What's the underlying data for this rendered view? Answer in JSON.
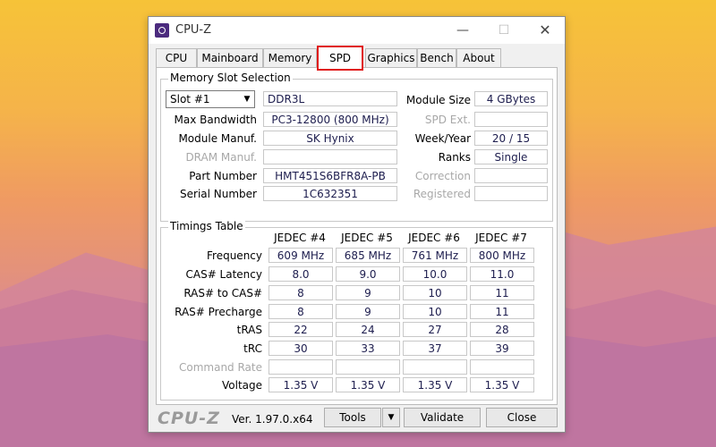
{
  "window": {
    "title": "CPU-Z"
  },
  "tabs": [
    "CPU",
    "Mainboard",
    "Memory",
    "SPD",
    "Graphics",
    "Bench",
    "About"
  ],
  "active_tab": "SPD",
  "memory_slot": {
    "group_label": "Memory Slot Selection",
    "slot_value": "Slot #1",
    "type": "DDR3L",
    "max_bandwidth_label": "Max Bandwidth",
    "max_bandwidth": "PC3-12800 (800 MHz)",
    "module_manuf_label": "Module Manuf.",
    "module_manuf": "SK Hynix",
    "dram_manuf_label": "DRAM Manuf.",
    "dram_manuf": "",
    "part_number_label": "Part Number",
    "part_number": "HMT451S6BFR8A-PB",
    "serial_number_label": "Serial Number",
    "serial_number": "1C632351",
    "module_size_label": "Module Size",
    "module_size": "4 GBytes",
    "spd_ext_label": "SPD Ext.",
    "spd_ext": "",
    "week_year_label": "Week/Year",
    "week_year": "20 / 15",
    "ranks_label": "Ranks",
    "ranks": "Single",
    "correction_label": "Correction",
    "correction": "",
    "registered_label": "Registered",
    "registered": ""
  },
  "timings": {
    "group_label": "Timings Table",
    "columns": [
      "JEDEC #4",
      "JEDEC #5",
      "JEDEC #6",
      "JEDEC #7"
    ],
    "rows": [
      {
        "label": "Frequency",
        "values": [
          "609 MHz",
          "685 MHz",
          "761 MHz",
          "800 MHz"
        ]
      },
      {
        "label": "CAS# Latency",
        "values": [
          "8.0",
          "9.0",
          "10.0",
          "11.0"
        ]
      },
      {
        "label": "RAS# to CAS#",
        "values": [
          "8",
          "9",
          "10",
          "11"
        ]
      },
      {
        "label": "RAS# Precharge",
        "values": [
          "8",
          "9",
          "10",
          "11"
        ]
      },
      {
        "label": "tRAS",
        "values": [
          "22",
          "24",
          "27",
          "28"
        ]
      },
      {
        "label": "tRC",
        "values": [
          "30",
          "33",
          "37",
          "39"
        ]
      },
      {
        "label": "Command Rate",
        "values": [
          "",
          "",
          "",
          ""
        ]
      },
      {
        "label": "Voltage",
        "values": [
          "1.35 V",
          "1.35 V",
          "1.35 V",
          "1.35 V"
        ]
      }
    ]
  },
  "footer": {
    "brand": "CPU-Z",
    "version": "Ver. 1.97.0.x64",
    "tools_label": "Tools",
    "validate_label": "Validate",
    "close_label": "Close"
  },
  "colors": {
    "highlight": "#e01818",
    "value_text": "#1d1d4e"
  }
}
